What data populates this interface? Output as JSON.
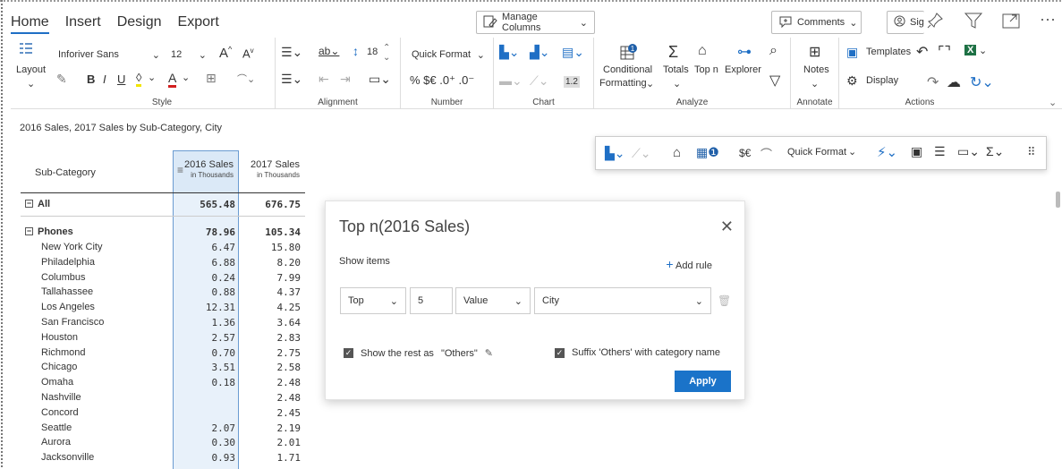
{
  "tabs": [
    "Home",
    "Insert",
    "Design",
    "Export"
  ],
  "top_buttons": {
    "manage_columns": "Manage Columns",
    "comments": "Comments",
    "sign": "Sig"
  },
  "ribbon": {
    "layout": "Layout",
    "font_name": "Inforiver Sans",
    "font_size": "12",
    "style_label": "Style",
    "spacing_value": "18",
    "alignment_label": "Alignment",
    "quick_format": "Quick Format",
    "number_symbols": "% $€ .0⁺ .0⁻",
    "number_label": "Number",
    "chart_value": "1.2",
    "chart_label": "Chart",
    "conditional": "Conditional",
    "formatting": "Formatting",
    "totals": "Totals",
    "topn": "Top n",
    "explorer": "Explorer",
    "analyze_label": "Analyze",
    "notes": "Notes",
    "annotate_label": "Annotate",
    "templates": "Templates",
    "display": "Display",
    "actions_label": "Actions",
    "badge_count": "1"
  },
  "subtitle": "2016 Sales, 2017 Sales by Sub-Category, City",
  "table": {
    "header_sub": "Sub-Category",
    "col1": {
      "title": "2016 Sales",
      "unit": "in Thousands"
    },
    "col2": {
      "title": "2017 Sales",
      "unit": "in Thousands"
    },
    "all_row": {
      "label": "All",
      "v1": "565.48",
      "v2": "676.75"
    },
    "group_row": {
      "label": "Phones",
      "v1": "78.96",
      "v2": "105.34"
    },
    "rows": [
      {
        "label": "New York City",
        "v1": "6.47",
        "v2": "15.80"
      },
      {
        "label": "Philadelphia",
        "v1": "6.88",
        "v2": "8.20"
      },
      {
        "label": "Columbus",
        "v1": "0.24",
        "v2": "7.99"
      },
      {
        "label": "Tallahassee",
        "v1": "0.88",
        "v2": "4.37"
      },
      {
        "label": "Los Angeles",
        "v1": "12.31",
        "v2": "4.25"
      },
      {
        "label": "San Francisco",
        "v1": "1.36",
        "v2": "3.64"
      },
      {
        "label": "Houston",
        "v1": "2.57",
        "v2": "2.83"
      },
      {
        "label": "Richmond",
        "v1": "0.70",
        "v2": "2.75"
      },
      {
        "label": "Chicago",
        "v1": "3.51",
        "v2": "2.58"
      },
      {
        "label": "Omaha",
        "v1": "0.18",
        "v2": "2.48"
      },
      {
        "label": "Nashville",
        "v1": "",
        "v2": "2.48"
      },
      {
        "label": "Concord",
        "v1": "",
        "v2": "2.45"
      },
      {
        "label": "Seattle",
        "v1": "2.07",
        "v2": "2.19"
      },
      {
        "label": "Aurora",
        "v1": "0.30",
        "v2": "2.01"
      },
      {
        "label": "Jacksonville",
        "v1": "0.93",
        "v2": "1.71"
      }
    ]
  },
  "float_toolbar": {
    "quick_format": "Quick Format",
    "currency": "$€"
  },
  "dialog": {
    "title": "Top n(2016 Sales)",
    "show_items": "Show items",
    "add_rule": "Add rule",
    "direction": "Top",
    "count": "5",
    "measure": "Value",
    "field": "City",
    "show_rest": "Show the rest as",
    "others_label": "\"Others\"",
    "suffix": "Suffix 'Others' with category name",
    "apply": "Apply"
  },
  "colors": {
    "accent": "#1a73c9",
    "column_highlight": "#e8f1fa",
    "excel_green": "#1e7145"
  }
}
